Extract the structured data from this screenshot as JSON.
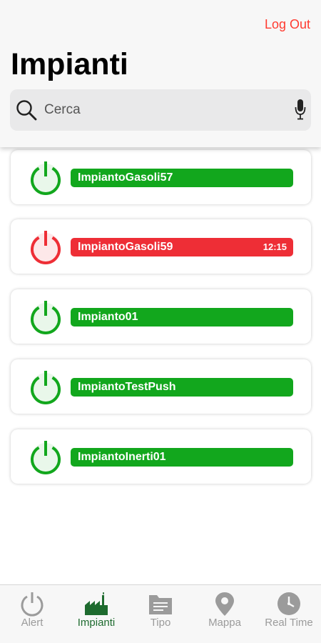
{
  "header": {
    "logout_label": "Log Out",
    "title": "Impianti",
    "search": {
      "placeholder": "Cerca"
    }
  },
  "colors": {
    "ok": "#12a71d",
    "alarm": "#ee2e36",
    "accent_red": "#ff3b30",
    "tab_active": "#1e6b2f",
    "tab_inactive": "#9b9b9b"
  },
  "plants": [
    {
      "name": "ImpiantoGasoli57",
      "status": "ok",
      "time": ""
    },
    {
      "name": "ImpiantoGasoli59",
      "status": "alarm",
      "time": "12:15"
    },
    {
      "name": "Impianto01",
      "status": "ok",
      "time": ""
    },
    {
      "name": "ImpiantoTestPush",
      "status": "ok",
      "time": ""
    },
    {
      "name": "ImpiantoInerti01",
      "status": "ok",
      "time": ""
    }
  ],
  "tabbar": {
    "tabs": [
      {
        "label": "Alert",
        "icon": "power-icon",
        "active": false
      },
      {
        "label": "Impianti",
        "icon": "factory-icon",
        "active": true
      },
      {
        "label": "Tipo",
        "icon": "folder-icon",
        "active": false
      },
      {
        "label": "Mappa",
        "icon": "map-pin-icon",
        "active": false
      },
      {
        "label": "Real Time",
        "icon": "clock-icon",
        "active": false
      }
    ]
  }
}
